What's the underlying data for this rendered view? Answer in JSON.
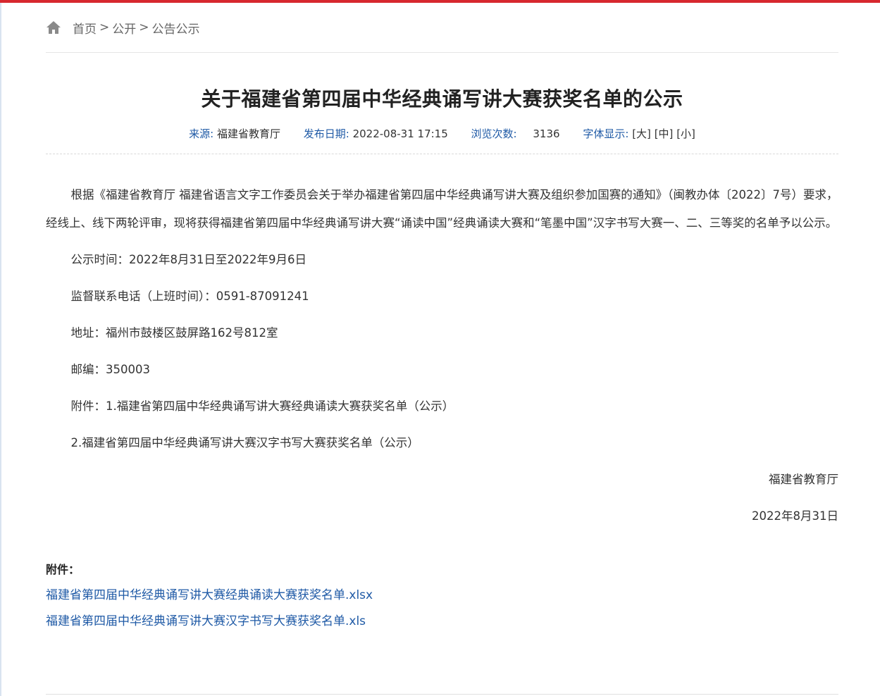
{
  "breadcrumb": {
    "home": "首页",
    "sep1": ">",
    "level1": "公开",
    "sep2": ">",
    "level2": "公告公示"
  },
  "article": {
    "title": "关于福建省第四届中华经典诵写讲大赛获奖名单的公示",
    "meta": {
      "source_label": "来源:",
      "source_value": "福建省教育厅",
      "date_label": "发布日期:",
      "date_value": "2022-08-31 17:15",
      "views_label": "浏览次数:",
      "views_value": "3136",
      "font_label": "字体显示:",
      "font_large": "[大]",
      "font_medium": "[中]",
      "font_small": "[小]"
    },
    "body": {
      "para1": "根据《福建省教育厅 福建省语言文字工作委员会关于举办福建省第四届中华经典诵写讲大赛及组织参加国赛的通知》（闽教办体〔2022〕7号）要求，经线上、线下两轮评审，现将获得福建省第四届中华经典诵写讲大赛“诵读中国”经典诵读大赛和“笔墨中国”汉字书写大赛一、二、三等奖的名单予以公示。",
      "period": "公示时间：2022年8月31日至2022年9月6日",
      "phone": "监督联系电话（上班时间）：0591-87091241",
      "address": "地址：福州市鼓楼区鼓屏路162号812室",
      "postcode": "邮编：350003",
      "attach1": "附件：1.福建省第四届中华经典诵写讲大赛经典诵读大赛获奖名单（公示）",
      "attach2": "2.福建省第四届中华经典诵写讲大赛汉字书写大赛获奖名单（公示）",
      "signer": "福建省教育厅",
      "sign_date": "2022年8月31日"
    },
    "attachments": {
      "heading": "附件：",
      "files": [
        "福建省第四届中华经典诵写讲大赛经典诵读大赛获奖名单.xlsx",
        "福建省第四届中华经典诵写讲大赛汉字书写大赛获奖名单.xls"
      ]
    }
  },
  "colors": {
    "accent_red": "#d7282e",
    "link_blue": "#1f5aa6"
  },
  "icons": {
    "home": "home-icon"
  }
}
